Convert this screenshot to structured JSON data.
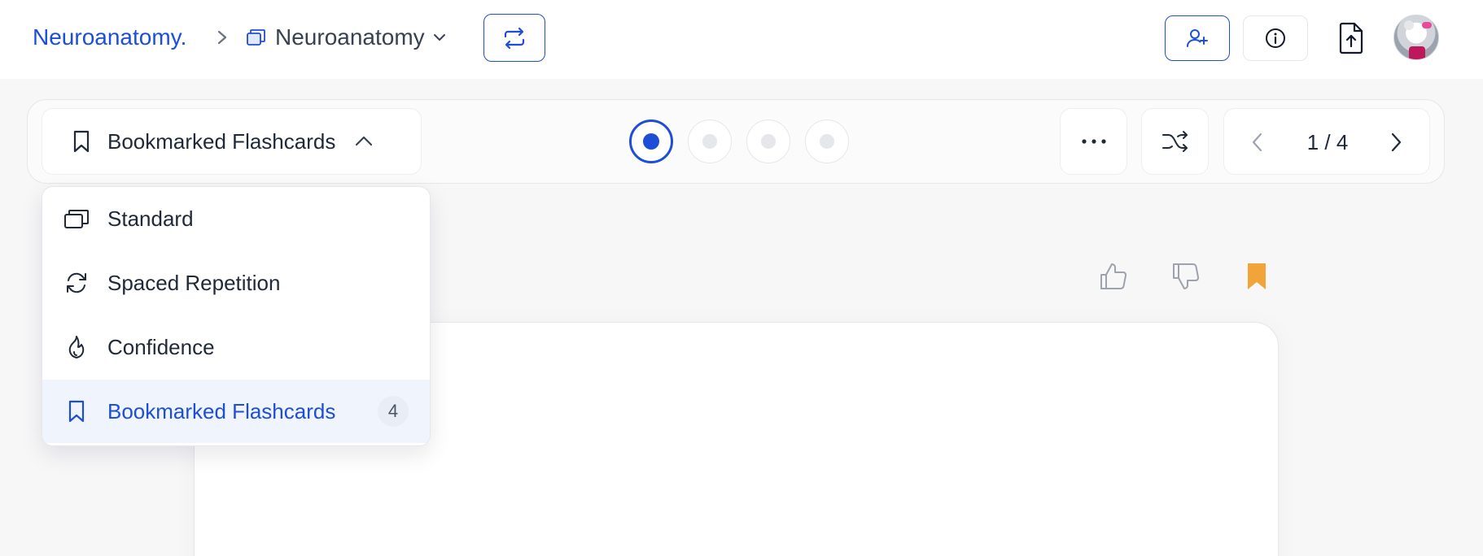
{
  "breadcrumb": {
    "root": "Neuroanatomy.",
    "deck": "Neuroanatomy"
  },
  "header": {
    "icons": [
      "swap-icon",
      "add-user-icon",
      "info-icon",
      "file-upload-icon",
      "avatar"
    ]
  },
  "toolbar": {
    "mode_label": "Bookmarked Flashcards",
    "progress_dots": {
      "total": 4,
      "active_index": 0
    },
    "pager": "1 / 4"
  },
  "dropdown": {
    "items": [
      {
        "label": "Standard",
        "icon": "cards-icon"
      },
      {
        "label": "Spaced Repetition",
        "icon": "refresh-icon"
      },
      {
        "label": "Confidence",
        "icon": "flame-icon"
      },
      {
        "label": "Bookmarked Flashcards",
        "icon": "bookmark-icon",
        "count": "4",
        "selected": true
      }
    ]
  },
  "colors": {
    "accent": "#1d4ed8",
    "bookmark": "#f0a43a",
    "selected_bg": "#eff4fd"
  }
}
